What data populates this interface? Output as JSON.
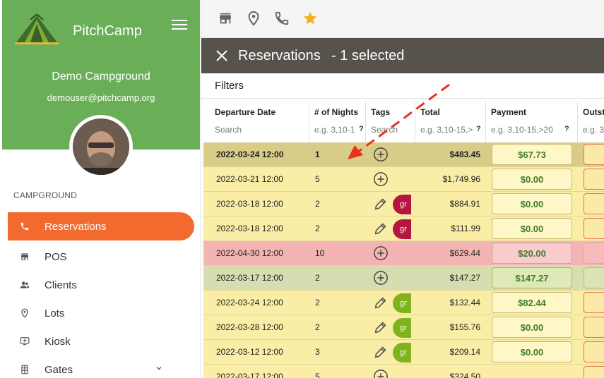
{
  "sidebar": {
    "brand": "PitchCamp",
    "campground_name": "Demo Campground",
    "email": "demouser@pitchcamp.org",
    "section_label": "CAMPGROUND",
    "items": [
      {
        "label": "Reservations",
        "icon": "phone-icon",
        "active": true
      },
      {
        "label": "POS",
        "icon": "store-icon"
      },
      {
        "label": "Clients",
        "icon": "people-icon"
      },
      {
        "label": "Lots",
        "icon": "location-icon"
      },
      {
        "label": "Kiosk",
        "icon": "kiosk-icon"
      },
      {
        "label": "Gates",
        "icon": "gate-icon"
      }
    ]
  },
  "toolbar": {
    "icons": [
      "store-icon",
      "location-icon",
      "phone-icon",
      "star-icon"
    ],
    "accent": "#f2b01e"
  },
  "selection_bar": {
    "title": "Reservations",
    "subtitle": "- 1 selected"
  },
  "filters_label": "Filters",
  "table": {
    "columns": [
      {
        "label": "Departure Date",
        "placeholder": "Search",
        "help": ""
      },
      {
        "label": "# of Nights",
        "placeholder": "e.g. 3,10-1",
        "help": "?"
      },
      {
        "label": "Tags",
        "placeholder": "Search",
        "help": ""
      },
      {
        "label": "Total",
        "placeholder": "e.g. 3,10-15,>",
        "help": "?"
      },
      {
        "label": "Payment",
        "placeholder": "e.g. 3,10-15,>20",
        "help": "?"
      },
      {
        "label": "Outst",
        "placeholder": "e.g. 3",
        "help": ""
      }
    ],
    "rows": [
      {
        "date": "2022-03-24 12:00",
        "nights": "1",
        "tag": "add",
        "chip": "",
        "total": "$483.45",
        "payment": "$67.73",
        "status": "selected"
      },
      {
        "date": "2022-03-21 12:00",
        "nights": "5",
        "tag": "add",
        "chip": "",
        "total": "$1,749.96",
        "payment": "$0.00",
        "status": "yellow"
      },
      {
        "date": "2022-03-18 12:00",
        "nights": "2",
        "tag": "edit",
        "chip": "gr",
        "chip_color": "#b5163f",
        "total": "$884.91",
        "payment": "$0.00",
        "status": "yellow"
      },
      {
        "date": "2022-03-18 12:00",
        "nights": "2",
        "tag": "edit",
        "chip": "gr",
        "chip_color": "#b5163f",
        "total": "$111.99",
        "payment": "$0.00",
        "status": "yellow"
      },
      {
        "date": "2022-04-30 12:00",
        "nights": "10",
        "tag": "add",
        "chip": "",
        "total": "$629.44",
        "payment": "$20.00",
        "status": "red"
      },
      {
        "date": "2022-03-17 12:00",
        "nights": "2",
        "tag": "add",
        "chip": "",
        "total": "$147.27",
        "payment": "$147.27",
        "status": "green"
      },
      {
        "date": "2022-03-24 12:00",
        "nights": "2",
        "tag": "edit",
        "chip": "gr",
        "chip_color": "#7fb21c",
        "total": "$132.44",
        "payment": "$82.44",
        "status": "yellow"
      },
      {
        "date": "2022-03-28 12:00",
        "nights": "2",
        "tag": "edit",
        "chip": "gr",
        "chip_color": "#7fb21c",
        "total": "$155.76",
        "payment": "$0.00",
        "status": "yellow"
      },
      {
        "date": "2022-03-12 12:00",
        "nights": "3",
        "tag": "edit",
        "chip": "gr",
        "chip_color": "#7fb21c",
        "total": "$209.14",
        "payment": "$0.00",
        "status": "yellow"
      },
      {
        "date": "2022-03-17 12:00",
        "nights": "5",
        "tag": "add",
        "chip": "",
        "total": "$324.50",
        "payment": "",
        "status": "yellow"
      }
    ]
  },
  "colors": {
    "sidebar_header": "#6aaf57",
    "active_nav": "#f26a2e",
    "selection_bar": "#57524b",
    "arrow": "#e8321e"
  }
}
